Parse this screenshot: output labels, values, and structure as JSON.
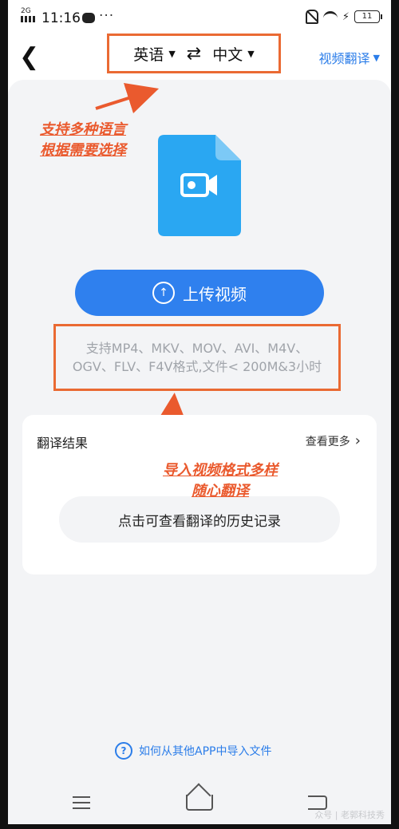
{
  "status_bar": {
    "network": "2G",
    "time": "11:16",
    "more": "···",
    "battery": "11"
  },
  "header": {
    "source_lang": "英语",
    "target_lang": "中文",
    "mode": "视频翻译",
    "colors": {
      "accent": "#2b7de9",
      "highlight_border": "#ea6a33"
    }
  },
  "annotations": {
    "note_languages": [
      "支持多种语言",
      "根据需要选择"
    ],
    "note_formats": [
      "导入视频格式多样",
      "随心翻译"
    ]
  },
  "upload": {
    "button_label": "上传视频",
    "formats_text": "支持MP4、MKV、MOV、AVI、M4V、OGV、FLV、F4V格式,文件< 200M&3小时"
  },
  "result": {
    "title": "翻译结果",
    "more_label": "查看更多",
    "history_label": "点击可查看翻译的历史记录"
  },
  "help": {
    "label": "如何从其他APP中导入文件"
  },
  "watermark": "众号 | 老郭科技秀"
}
